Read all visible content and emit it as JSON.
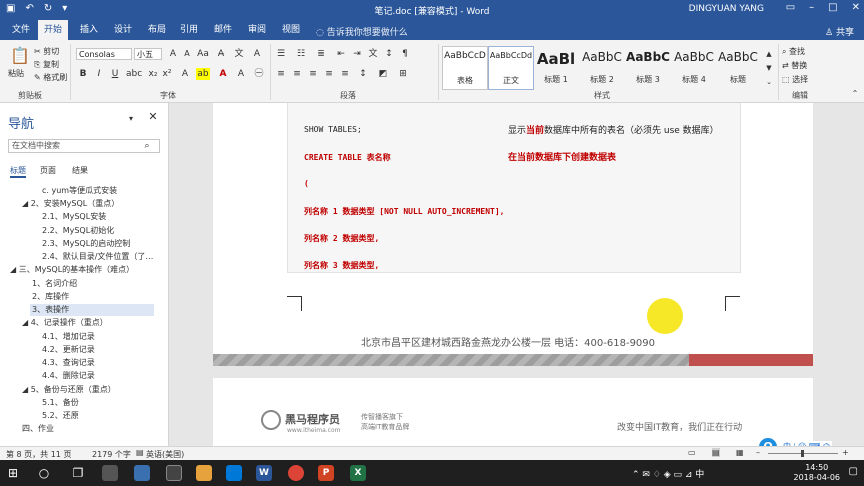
{
  "window": {
    "title": "笔记.doc [兼容模式] - Word",
    "user": "DINGYUAN YANG",
    "share": "共享",
    "tell_me": "告诉我你想要做什么"
  },
  "ribbon_tabs": [
    "文件",
    "开始",
    "插入",
    "设计",
    "布局",
    "引用",
    "邮件",
    "审阅",
    "视图"
  ],
  "clipboard": {
    "paste": "粘贴",
    "cut": "剪切",
    "copy": "复制",
    "format_painter": "格式刷",
    "group": "剪贴板"
  },
  "font": {
    "name": "Consolas",
    "size": "小五",
    "group": "字体"
  },
  "paragraph": {
    "group": "段落"
  },
  "styles": {
    "group": "样式",
    "items": [
      {
        "preview": "AaBbCcD",
        "label": "表格"
      },
      {
        "preview": "AaBbCcDd",
        "label": "正文"
      },
      {
        "preview": "AaBl",
        "label": "标题 1"
      },
      {
        "preview": "AaBbC",
        "label": "标题 2"
      },
      {
        "preview": "AaBbC",
        "label": "标题 3"
      },
      {
        "preview": "AaBbC",
        "label": "标题 4"
      },
      {
        "preview": "AaBbC",
        "label": "标题"
      }
    ]
  },
  "editing": {
    "find": "查找",
    "replace": "替换",
    "select": "选择",
    "group": "编辑"
  },
  "nav": {
    "title": "导航",
    "search_placeholder": "在文档中搜索",
    "tabs": [
      "标题",
      "页面",
      "结果"
    ],
    "items": [
      "c. yum等便瓜式安装",
      "◢  2、安装MySQL（重点）",
      "2.1、MySQL安装",
      "2.2、MySQL初始化",
      "2.3、MySQL的启动控制",
      "2.4、默认目录/文件位置（了…",
      "◢ 三、MySQL的基本操作（难点）",
      "1、名词介绍",
      "2、库操作",
      "3、表操作",
      "◢  4、记录操作（重点）",
      "4.1、增加记录",
      "4.2、更新记录",
      "4.3、查询记录",
      "4.4、删除记录",
      "◢  5、备份与还原（重点）",
      "5.1、备份",
      "5.2、还原",
      "四、作业"
    ]
  },
  "doc": {
    "line1_code": "SHOW TABLES;",
    "line1_note_a": "显示",
    "line1_note_b": "当前",
    "line1_note_c": "数据库中所有的表名（必须先 use 数据库）",
    "line2_code": "CREATE TABLE 表名称",
    "line2_note": "在当前数据库下创建数据表",
    "line3": "(",
    "line4": "列名称 1 数据类型 [NOT NULL AUTO_INCREMENT],",
    "line5": "列名称 2 数据类型,",
    "line6": "列名称 3 数据类型,",
    "footer": "北京市昌平区建材城西路金燕龙办公楼一层    电话：400-618-9090",
    "logo_name": "黑马程序员",
    "logo_url": "www.itheima.com",
    "logo_tag1": "传智播客旗下",
    "logo_tag2": "高端IT教育品牌",
    "slogan": "改变中国IT教育，我们正在行动"
  },
  "status": {
    "page": "第 8 页，共 11 页",
    "words": "2179 个字",
    "lang": "英语(美国)",
    "zoom": "+"
  },
  "taskbar": {
    "time": "14:50",
    "date": "2018-04-06"
  }
}
